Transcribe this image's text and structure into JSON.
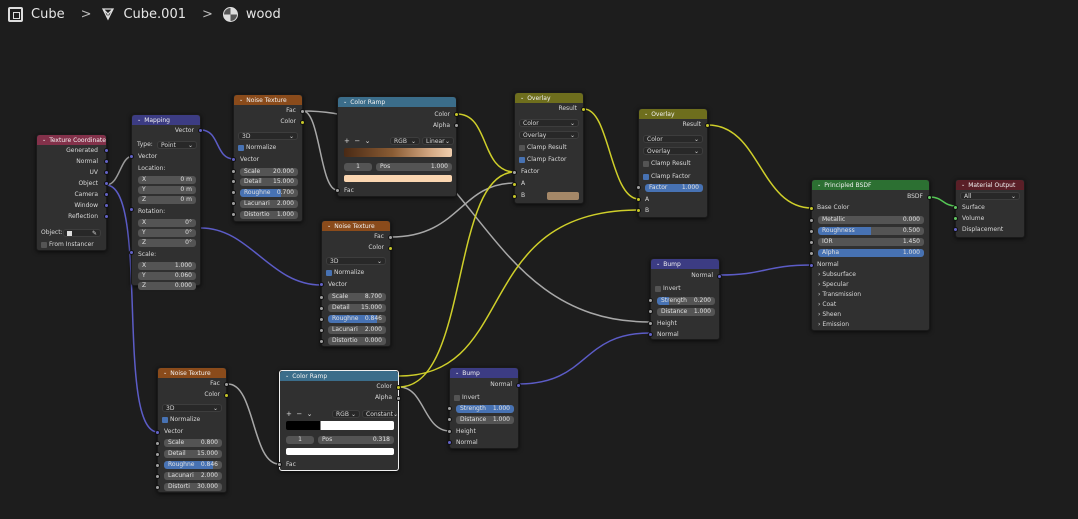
{
  "breadcrumb": {
    "object": "Cube",
    "mesh": "Cube.001",
    "material": "wood"
  },
  "texcoord": {
    "title": "Texture Coordinate",
    "outputs": [
      "Generated",
      "Normal",
      "UV",
      "Object",
      "Camera",
      "Window",
      "Reflection"
    ],
    "object_label": "Object:",
    "from_instancer": "From Instancer"
  },
  "mapping": {
    "title": "Mapping",
    "vector_out": "Vector",
    "type_label": "Type:",
    "type_value": "Point",
    "vector_in": "Vector",
    "location": "Location:",
    "loc": [
      [
        "X",
        "0 m"
      ],
      [
        "Y",
        "0 m"
      ],
      [
        "Z",
        "0 m"
      ]
    ],
    "rotation": "Rotation:",
    "rot": [
      [
        "X",
        "0°"
      ],
      [
        "Y",
        "0°"
      ],
      [
        "Z",
        "0°"
      ]
    ],
    "scale": "Scale:",
    "scl": [
      [
        "X",
        "1.000"
      ],
      [
        "Y",
        "0.060"
      ],
      [
        "Z",
        "0.000"
      ]
    ]
  },
  "noise1": {
    "title": "Noise Texture",
    "fac": "Fac",
    "color": "Color",
    "dim": "3D",
    "normalize": "Normalize",
    "vector": "Vector",
    "fields": [
      [
        "Scale",
        "20.000"
      ],
      [
        "Detail",
        "15.000"
      ],
      [
        "Roughne",
        "0.700"
      ],
      [
        "Lacunari",
        "2.000"
      ],
      [
        "Distortio",
        "1.000"
      ]
    ],
    "roughness": 0.7
  },
  "noise2": {
    "title": "Noise Texture",
    "fac": "Fac",
    "color": "Color",
    "dim": "3D",
    "normalize": "Normalize",
    "vector": "Vector",
    "fields": [
      [
        "Scale",
        "8.700"
      ],
      [
        "Detail",
        "15.000"
      ],
      [
        "Roughne",
        "0.846"
      ],
      [
        "Lacunari",
        "2.000"
      ],
      [
        "Distortio",
        "0.000"
      ]
    ],
    "roughness": 0.846
  },
  "noise3": {
    "title": "Noise Texture",
    "fac": "Fac",
    "color": "Color",
    "dim": "3D",
    "normalize": "Normalize",
    "vector": "Vector",
    "fields": [
      [
        "Scale",
        "0.800"
      ],
      [
        "Detail",
        "15.000"
      ],
      [
        "Roughne",
        "0.846"
      ],
      [
        "Lacunari",
        "2.000"
      ],
      [
        "Distorti",
        "30.000"
      ]
    ],
    "roughness": 0.846
  },
  "ramp1": {
    "title": "Color Ramp",
    "color": "Color",
    "alpha": "Alpha",
    "mode": "RGB",
    "interp": "Linear",
    "index": "1",
    "pos_label": "Pos",
    "pos": "1.000",
    "fac": "Fac",
    "swatch": "#fbd6b1"
  },
  "ramp2": {
    "title": "Color Ramp",
    "color": "Color",
    "alpha": "Alpha",
    "mode": "RGB",
    "interp": "Constant",
    "index": "1",
    "pos_label": "Pos",
    "pos": "0.318",
    "fac": "Fac",
    "swatch": "#ffffff"
  },
  "overlay1": {
    "title": "Overlay",
    "result": "Result",
    "type": "Color",
    "blend": "Overlay",
    "clamp_result": "Clamp Result",
    "clamp_factor": "Clamp Factor",
    "factor": "Factor",
    "a": "A",
    "b": "B",
    "b_color": "#a58868"
  },
  "overlay2": {
    "title": "Overlay",
    "result": "Result",
    "type": "Color",
    "blend": "Overlay",
    "clamp_result": "Clamp Result",
    "clamp_factor": "Clamp Factor",
    "factor_label": "Factor",
    "factor_value": "1.000",
    "a": "A",
    "b": "B"
  },
  "bump1": {
    "title": "Bump",
    "normal_out": "Normal",
    "invert": "Invert",
    "strength_label": "Strength",
    "strength": "0.200",
    "distance_label": "Distance",
    "distance": "1.000",
    "height": "Height",
    "normal_in": "Normal",
    "strength_fill": 0.2
  },
  "bump2": {
    "title": "Bump",
    "normal_out": "Normal",
    "invert": "Invert",
    "strength_label": "Strength",
    "strength": "1.000",
    "distance_label": "Distance",
    "distance": "1.000",
    "height": "Height",
    "normal_in": "Normal",
    "strength_fill": 1.0
  },
  "bsdf": {
    "title": "Principled BSDF",
    "bsdf_out": "BSDF",
    "base_color": "Base Color",
    "fields": [
      [
        "Metallic",
        "0.000",
        0.0
      ],
      [
        "Roughness",
        "0.500",
        0.5
      ],
      [
        "IOR",
        "1.450",
        0.0
      ],
      [
        "Alpha",
        "1.000",
        1.0
      ]
    ],
    "normal": "Normal",
    "panels": [
      "Subsurface",
      "Specular",
      "Transmission",
      "Coat",
      "Sheen",
      "Emission"
    ]
  },
  "output": {
    "title": "Material Output",
    "target": "All",
    "surface": "Surface",
    "volume": "Volume",
    "displacement": "Displacement"
  },
  "colors": {
    "background": "#1d1d1d",
    "node_body": "#303030",
    "field": "#545454",
    "accent": "#4772b3",
    "wire_gray": "#a8a8a8",
    "wire_yellow": "#d8d82e",
    "wire_blue": "#5c5cc7"
  }
}
